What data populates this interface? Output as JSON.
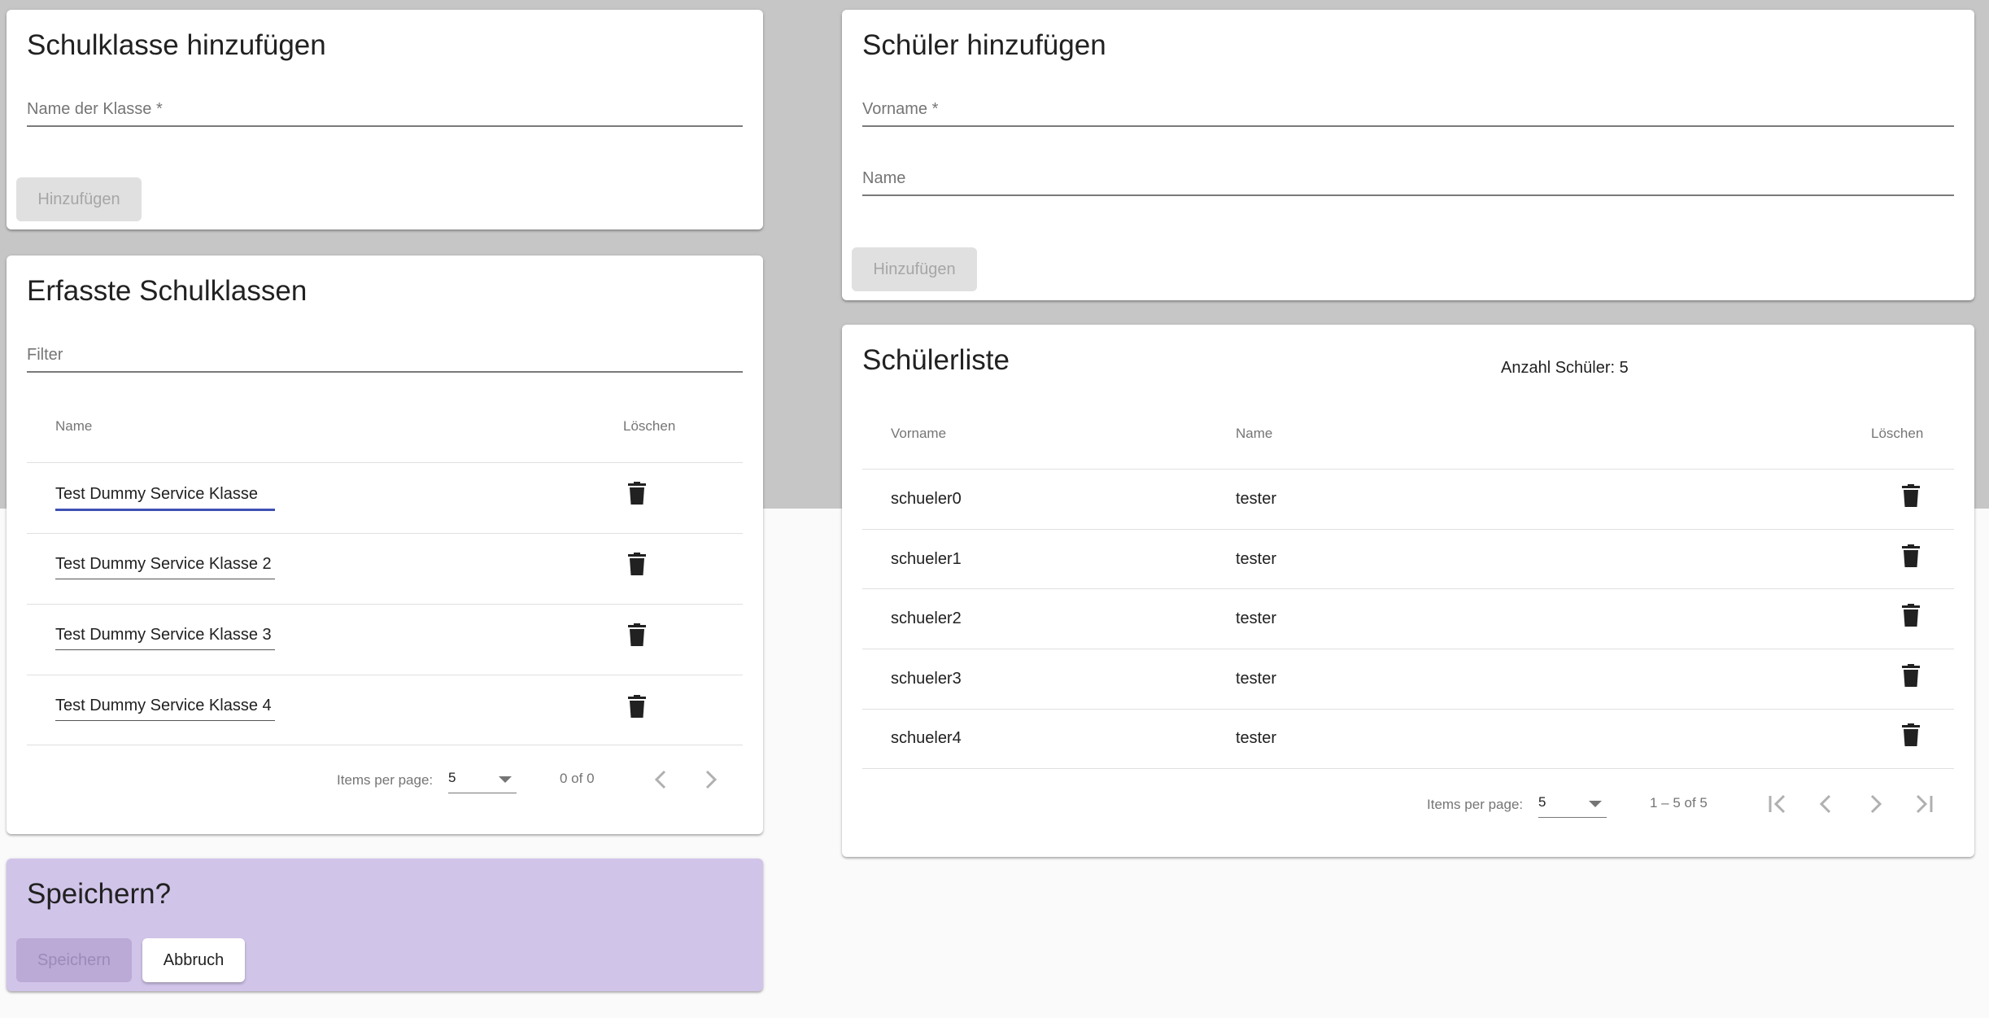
{
  "add_class": {
    "title": "Schulklasse hinzufügen",
    "name_placeholder": "Name der Klasse *",
    "add_button": "Hinzufügen"
  },
  "class_list": {
    "title": "Erfasste Schulklassen",
    "filter_placeholder": "Filter",
    "columns": {
      "name": "Name",
      "delete": "Löschen"
    },
    "rows": [
      {
        "name": "Test Dummy Service Klasse"
      },
      {
        "name": "Test Dummy Service Klasse 2"
      },
      {
        "name": "Test Dummy Service Klasse 3"
      },
      {
        "name": "Test Dummy Service Klasse 4"
      }
    ],
    "paginator": {
      "items_per_page_label": "Items per page:",
      "page_size": "5",
      "range": "0 of 0"
    }
  },
  "save": {
    "title": "Speichern?",
    "save_button": "Speichern",
    "cancel_button": "Abbruch"
  },
  "add_student": {
    "title": "Schüler hinzufügen",
    "first_name_placeholder": "Vorname *",
    "name_placeholder": "Name",
    "add_button": "Hinzufügen"
  },
  "student_list": {
    "title": "Schülerliste",
    "count_text": "Anzahl Schüler: 5",
    "columns": {
      "first_name": "Vorname",
      "name": "Name",
      "delete": "Löschen"
    },
    "rows": [
      {
        "first_name": "schueler0",
        "name": "tester"
      },
      {
        "first_name": "schueler1",
        "name": "tester"
      },
      {
        "first_name": "schueler2",
        "name": "tester"
      },
      {
        "first_name": "schueler3",
        "name": "tester"
      },
      {
        "first_name": "schueler4",
        "name": "tester"
      }
    ],
    "paginator": {
      "items_per_page_label": "Items per page:",
      "page_size": "5",
      "range": "1 – 5 of 5"
    }
  },
  "colors": {
    "focus_underline": "#3f51b5",
    "save_card_bg": "#d1c4e9",
    "top_background": "#c6c6c6"
  }
}
